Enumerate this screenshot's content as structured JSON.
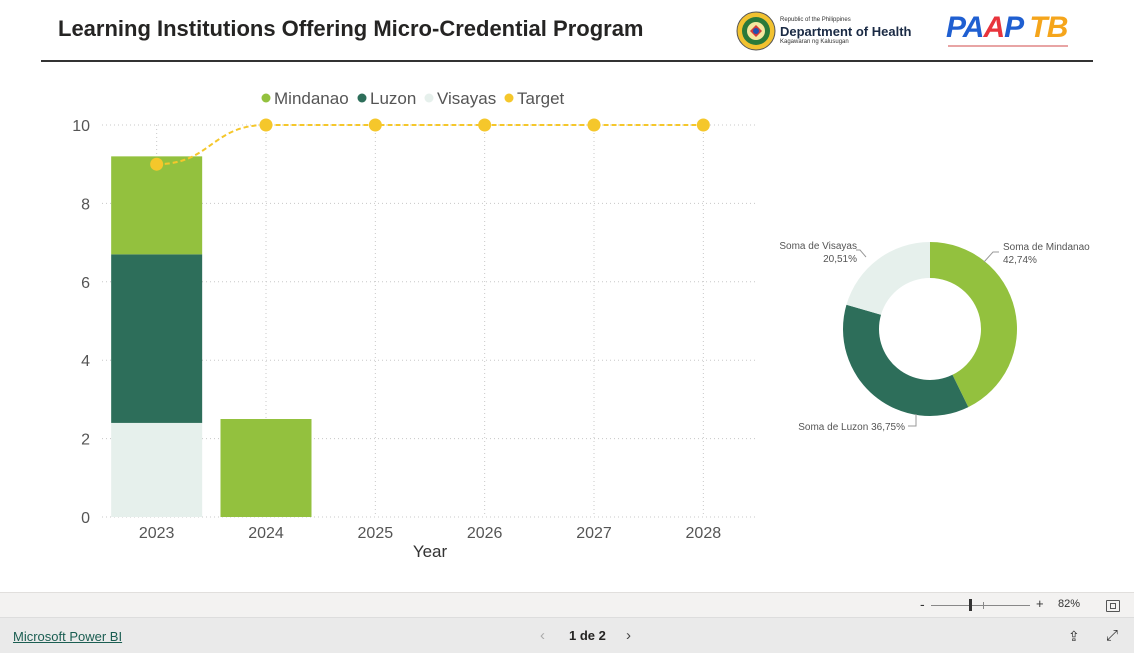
{
  "header": {
    "title": "Learning Institutions Offering Micro-Credential Program",
    "doh_small": "Republic of the Philippines",
    "doh_main": "Department of Health",
    "doh_sub": "Kagawaran ng Kalusugan",
    "paap_logo": "PAAP TB"
  },
  "colors": {
    "mindanao": "#93c13e",
    "luzon": "#2d6e5a",
    "visayas": "#e6f0ec",
    "target": "#f5c72b",
    "grid": "#c8c8c8",
    "text": "#555555"
  },
  "chart_data": [
    {
      "type": "bar",
      "stacked": true,
      "xlabel": "Year",
      "categories": [
        "2023",
        "2024",
        "2025",
        "2026",
        "2027",
        "2028"
      ],
      "ylim": [
        0,
        10
      ],
      "yticks": [
        0,
        2,
        4,
        6,
        8,
        10
      ],
      "legend": [
        "Mindanao",
        "Luzon",
        "Visayas",
        "Target"
      ],
      "legend_position": "top",
      "series": [
        {
          "name": "Visayas",
          "values": [
            2.4,
            0,
            0,
            0,
            0,
            0
          ]
        },
        {
          "name": "Luzon",
          "values": [
            4.3,
            0,
            0,
            0,
            0,
            0
          ]
        },
        {
          "name": "Mindanao",
          "values": [
            2.5,
            2.5,
            0,
            0,
            0,
            0
          ]
        }
      ],
      "line": {
        "name": "Target",
        "values": [
          9,
          10,
          10,
          10,
          10,
          10
        ],
        "style": "dashed"
      },
      "grid": true
    },
    {
      "type": "pie",
      "donut": true,
      "slices": [
        {
          "label": "Soma de Mindanao",
          "pct": "42,74%",
          "value": 42.74
        },
        {
          "label": "Soma de Luzon",
          "pct": "36,75%",
          "value": 36.75
        },
        {
          "label": "Soma de Visayas",
          "pct": "20,51%",
          "value": 20.51
        }
      ]
    }
  ],
  "footer": {
    "zoom_minus": "-",
    "zoom_plus": "+",
    "zoom_value": "82%",
    "brand_link": "Microsoft Power BI",
    "pager": "1 de 2",
    "prev_icon": "chevron-left-icon",
    "next_icon": "chevron-right-icon",
    "share_icon": "share-icon",
    "expand_icon": "expand-icon",
    "fit_icon": "fit-to-page-icon"
  }
}
